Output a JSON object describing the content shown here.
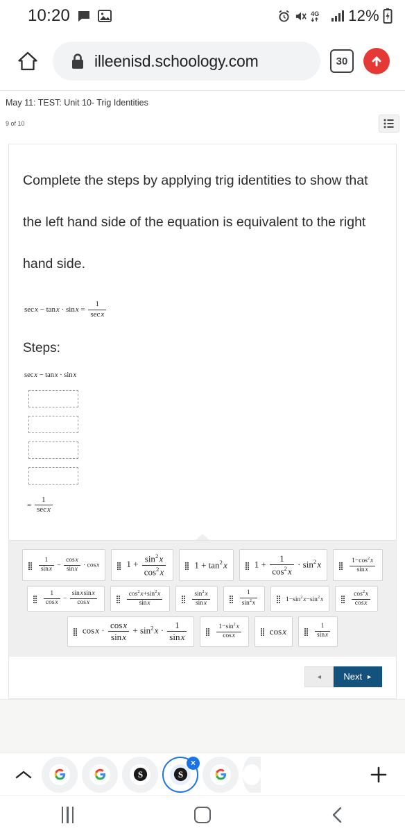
{
  "status_bar": {
    "time": "10:20",
    "battery_percent": "12%",
    "network": "4G",
    "icons": [
      "message-icon",
      "image-icon",
      "alarm-icon",
      "mute-icon",
      "network-4g-icon",
      "signal-icon",
      "battery-charging-icon"
    ]
  },
  "browser": {
    "url": "illeenisd.schoology.com",
    "tab_count": "30",
    "home_icon": "home-icon",
    "lock_icon": "lock-icon",
    "download_icon": "download-arrow-icon"
  },
  "assessment": {
    "title": "May 11: TEST: Unit 10- Trig Identities",
    "progress": "9 of 10",
    "list_icon": "list-icon"
  },
  "question": {
    "prompt": "Complete the steps by applying trig identities to show that the left hand side of the equation is equivalent to the right hand side.",
    "equation": "sec x − tan x · sin x = 1/(sec x)",
    "steps_heading": "Steps:",
    "first_step": "sec x − tan x · sin x",
    "last_step": "= 1/(sec x)",
    "blank_count": 4
  },
  "tiles": [
    {
      "id": "tile-1",
      "row": 1,
      "latex": "1/(sin x) − (cos x)/(sin x) · cos x"
    },
    {
      "id": "tile-2",
      "row": 1,
      "latex": "1 + (sin² x)/(cos² x)"
    },
    {
      "id": "tile-3",
      "row": 1,
      "latex": "1 + tan² x"
    },
    {
      "id": "tile-4",
      "row": 1,
      "latex": "1 + 1/(cos² x) · sin² x"
    },
    {
      "id": "tile-5",
      "row": 1,
      "latex": "(1 − cos² x)/(sin x)"
    },
    {
      "id": "tile-6",
      "row": 1,
      "latex": "1/(cos x) − (sin x · sin x)/(cos x)"
    },
    {
      "id": "tile-7",
      "row": 2,
      "latex": "(cos² x + sin² x)/(sin x)"
    },
    {
      "id": "tile-8",
      "row": 2,
      "latex": "(sin² x)/(sin x)"
    },
    {
      "id": "tile-9",
      "row": 2,
      "latex": "1/(sin² x)"
    },
    {
      "id": "tile-10",
      "row": 2,
      "latex": "1 − sin² x − sin² x"
    },
    {
      "id": "tile-11",
      "row": 2,
      "latex": "(cos² x)/(cos x)"
    },
    {
      "id": "tile-12",
      "row": 2,
      "latex": "cos x · (cos x)/(sin x) + sin² x · 1/(sin x)"
    },
    {
      "id": "tile-13",
      "row": 2,
      "latex": "(1 − sin² x)/(cos x)"
    },
    {
      "id": "tile-14",
      "row": 3,
      "latex": "cos x"
    },
    {
      "id": "tile-15",
      "row": 3,
      "latex": "1/(sin x)"
    }
  ],
  "navigation": {
    "prev_label": "◄",
    "next_label": "Next",
    "next_arrow": "►",
    "next_color": "#14527e"
  },
  "tab_strip": {
    "expand_icon": "chevron-up-icon",
    "new_tab_icon": "plus-icon",
    "close_label": "×",
    "tabs": [
      {
        "favicon": "google-icon",
        "active": false
      },
      {
        "favicon": "google-icon",
        "active": false
      },
      {
        "favicon": "schoology-icon",
        "active": false
      },
      {
        "favicon": "schoology-icon",
        "active": true
      },
      {
        "favicon": "google-icon",
        "active": false
      },
      {
        "favicon": "blank-icon",
        "active": false
      }
    ]
  },
  "android_nav": {
    "recents_icon": "recents-icon",
    "home_icon": "home-square-icon",
    "back_icon": "back-chevron-icon"
  }
}
